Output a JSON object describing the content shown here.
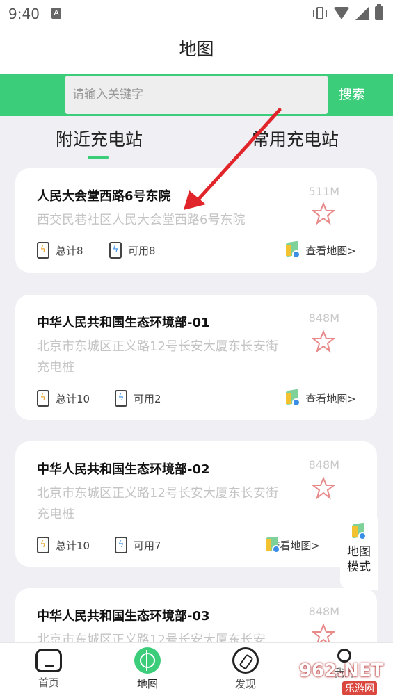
{
  "status_bar": {
    "time": "9:40",
    "notif_letter": "A"
  },
  "header": {
    "title": "地图"
  },
  "search": {
    "placeholder": "请输入关键字",
    "button_label": "搜索"
  },
  "tabs": [
    {
      "label": "附近充电站",
      "active": true
    },
    {
      "label": "常用充电站",
      "active": false
    }
  ],
  "stations": [
    {
      "name": "人民大会堂西路6号东院",
      "distance": "511M",
      "address": "西交民巷社区人民大会堂西路6号东院",
      "total": "总计8",
      "available": "可用8",
      "map_link": "查看地图>"
    },
    {
      "name": "中华人民共和国生态环境部-01",
      "distance": "848M",
      "address": "北京市东城区正义路12号长安大厦东长安街充电桩",
      "total": "总计10",
      "available": "可用2",
      "map_link": "查看地图>"
    },
    {
      "name": "中华人民共和国生态环境部-02",
      "distance": "848M",
      "address": "北京市东城区正义路12号长安大厦东长安街充电桩",
      "total": "总计10",
      "available": "可用7",
      "map_link": "查看地图>"
    },
    {
      "name": "中华人民共和国生态环境部-03",
      "distance": "848M",
      "address": "北京市东城区正义路12号长安大厦东长安",
      "total": "",
      "available": "",
      "map_link": ""
    }
  ],
  "map_mode_button": {
    "line1": "地图",
    "line2": "模式"
  },
  "bottom_nav": [
    {
      "label": "首页",
      "icon": "home-icon"
    },
    {
      "label": "地图",
      "icon": "map-target-icon",
      "active": true
    },
    {
      "label": "发现",
      "icon": "compass-icon"
    },
    {
      "label": "我的",
      "icon": "user-icon"
    }
  ],
  "watermark": {
    "brand": "962.NET",
    "sub": "乐游网"
  },
  "colors": {
    "accent": "#3ccd7a",
    "arrow": "#e0262a",
    "star": "#e88a8a"
  }
}
